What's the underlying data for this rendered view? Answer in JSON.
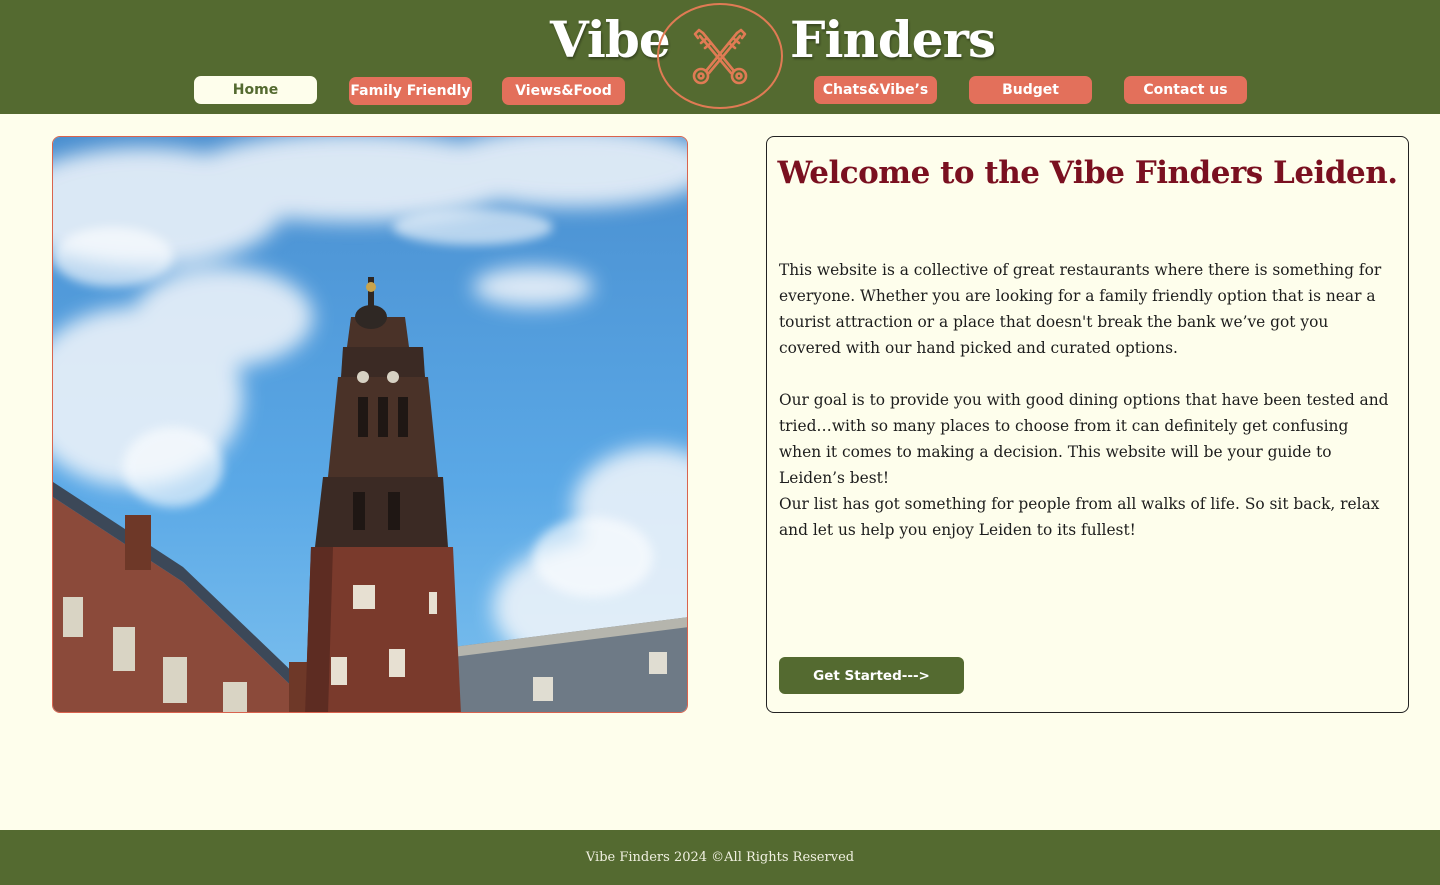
{
  "brand": {
    "left_word": "Vibe",
    "right_word": "Finders"
  },
  "logo": {
    "icon": "crossed-keys-icon"
  },
  "nav": {
    "home": "Home",
    "family": "Family Friendly",
    "views": "Views&Food",
    "chats": "Chats&Vibe’s",
    "budget": "Budget",
    "contact": "Contact us"
  },
  "hero_image": {
    "icon": "tower-photo"
  },
  "main": {
    "title": "Welcome to the Vibe Finders Leiden.",
    "p1": "This website is a collective of great restaurants where there is something for everyone. Whether you are looking for a family friendly option that is near a tourist attraction or a place that doesn't break the bank we’ve got you covered with our hand picked and curated options.",
    "p2": "Our goal is to provide you with good dining options that have been tested and tried…with so many places to choose from it can definitely get confusing when it comes to making a decision. This website will be your guide to Leiden’s best!",
    "p3": "Our list has got something for people from all walks of life. So sit back, relax and let us help you enjoy Leiden to its fullest!",
    "cta": "Get Started--->"
  },
  "footer": {
    "text": "Vibe Finders 2024 ©All Rights Reserved"
  },
  "colors": {
    "header_green": "#546a30",
    "nav_coral": "#e3705b",
    "page_cream": "#fefeec",
    "title_maroon": "#7a1020"
  }
}
